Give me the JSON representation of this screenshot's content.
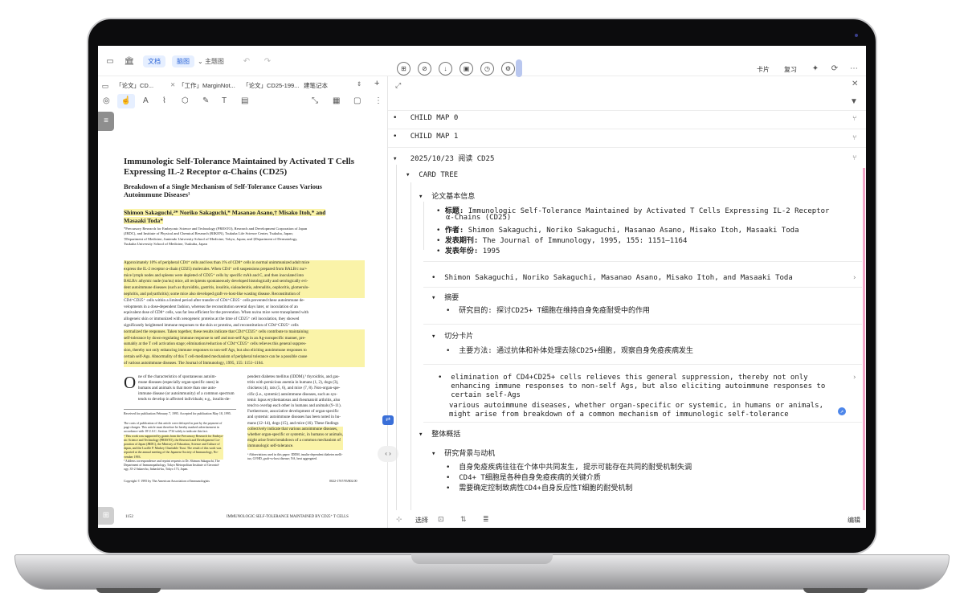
{
  "toolbar": {
    "tab_doc": "文档",
    "tab_map": "脑图",
    "theme_label": "主题图",
    "card_label": "卡片",
    "review_label": "复习"
  },
  "tabs": [
    "「论文」CD...",
    "「工作」MarginNot...",
    "「论文」CD25-199...",
    "建笔记本"
  ],
  "paper": {
    "title1": "Immunologic Self-Tolerance Maintained by Activated T Cells",
    "title2": "Expressing IL-2 Receptor α-Chains (CD25)",
    "subtitle1": "Breakdown of a Single Mechanism of Self-Tolerance Causes Various",
    "subtitle2": "Autoimmune Diseases¹",
    "authors1": "Shimon Sakaguchi,²* Noriko Sakaguchi,* Masanao Asano,† Misako Itoh,* and",
    "authors2": "Masaaki Toda*",
    "affil": [
      "*Precursory Research for Embryonic Science and Technology (PRESTO), Research and Development Corporation of Japan",
      "(JRDC), and Institute of Physical and Chemical Research (RIKEN), Tsukuba Life Science Center, Tsukuba, Japan;",
      "†Department of Medicine, Juntendo University School of Medicine, Tokyo, Japan; and ‡Department of Dermatology,",
      "Tsukuba University School of Medicine, Tsukuba, Japan"
    ],
    "abstract": [
      "Approximately 10% of peripheral CD4⁺ cells and less than 1% of CD8⁺ cells in normal unimmunized adult mice",
      "express the IL-2 receptor α-chain (CD25) molecules. When CD4⁺ cell suspensions prepared from BALB/c nu/+",
      "mice lymph nodes and spleens were depleted of CD25⁺ cells by specific mAb and C, and then inoculated into",
      "BALB/c athymic nude (nu/nu) mice, all recipients spontaneously developed histologically and serologically evi-",
      "dent autoimmune diseases (such as thyroiditis, gastritis, insulitis, sialoadenitis, adrenalitis, oophoritis, glomerulo-",
      "nephritis, and polyarthritis); some mice also developed graft-vs-host-like wasting disease. Reconstitution of",
      "CD4⁺CD25⁺ cells within a limited period after transfer of CD4⁺CD25⁻ cells prevented these autoimmune de-",
      "velopments in a dose-dependent fashion, whereas the reconstitution several days later, or inoculation of an",
      "equivalent dose of CD8⁺ cells, was far less efficient for the prevention. When nu/nu mice were transplanted with",
      "allogeneic skin or immunized with xenogeneic proteins at the time of CD25⁺ cell inoculation, they showed",
      "significantly heightened immune responses to the skin or proteins, and reconstitution of CD4⁺CD25⁺ cells",
      "normalized the responses. Taken together, these results indicate that CD4⁺CD25⁺ cells contribute to maintaining",
      "self-tolerance by down-regulating immune response to self and non-self Ags in an Ag-nonspecific manner, pre-",
      "sumably at the T cell activation stage; elimination/reduction of CD4⁺CD25⁺ cells relieves this general suppres-",
      "sion, thereby not only enhancing immune responses to non-self Ags, but also eliciting autoimmune responses to",
      "certain self-Ags. Abnormality of this T cell-mediated mechanism of peripheral tolerance can be a possible cause",
      "of various autoimmune diseases.    The Journal of Immunology, 1995, 155: 1151–1164."
    ],
    "col1": [
      "ne of the characteristics of spontaneous autoim-",
      "mune diseases (especially organ-specific ones) in",
      "humans and animals is that more than one auto-",
      "immune disease (or autoimmunity) of a common spectrum",
      "tends to develop in affected individuals; e.g., insulin-de-"
    ],
    "col2": [
      "pendent diabetes mellitus (IDDM),³ thyroiditis, and gas-",
      "tritis with pernicious anemia in humans (1, 2), dogs (3),",
      "chickens (4), rats (5, 6), and mice (7, 8). Non-organ-spe-",
      "cific (i.e., systemic) autoimmune diseases, such as sys-",
      "temic lupus erythematosus and rheumatoid arthritis, also",
      "tend to overlap each other in humans and animals (9–11).",
      "Furthermore, associative development of organ-specific",
      "and systemic autoimmune diseases has been noted in hu-",
      "mans (12–14), dogs (15), and mice (16). These findings",
      "collectively indicate that various autoimmune diseases,",
      "whether organ-specific or systemic, in humans or animals,",
      "might arise from breakdown of a common mechanism of",
      "immunologic self-tolerance."
    ],
    "received": "Received for publication February 7, 1995. Accepted for publication May 18, 1995.",
    "notes": [
      "The costs of publication of this article were defrayed in part by the payment of",
      "page charges. This article must therefore be hereby marked advertisement in",
      "accordance with 18 U.S.C. Section 1734 solely to indicate this fact.",
      "¹ This work was supported by grants from the Precursory Research for Embryo-",
      "nic Science and Technology (PRESTO), the Research and Development Cor-",
      "poration of Japan (JRDC), the Ministry of Education, Science and Culture of",
      "Japan, and the Lucille P. Markey Charitable Trust. The result of this work was",
      "reported at the annual meeting of the Japanese Society of Immunology, No-",
      "vember 1993.",
      "² Address correspondence and reprint requests to Dr. Shimon Sakaguchi, The",
      "Department of Immunopathology, Tokyo Metropolitan Institute of Gerontol-",
      "ogy, 35-2 Sakaecho, Itabashi-ku, Tokyo 173, Japan."
    ],
    "abbrev": [
      "³ Abbreviations used in this paper: IDDM, insulin-dependent diabetes melli-",
      "tus; GVHD, graft-vs-host disease; NA, beat aggregated."
    ],
    "copyright": "Copyright © 1995 by The American Association of Immunologists",
    "issn": "0022-1767/95/$02.00",
    "page_num": "1152",
    "running": "IMMUNOLOGIC SELF-TOLERANCE MAINTAINED BY CD25⁺ T CELLS"
  },
  "tree": {
    "child0": "CHILD MAP 0",
    "child1": "CHILD MAP 1",
    "date_node": "2025/10/23 阅读 CD25",
    "card_tree": "CARD TREE",
    "basic_info": "论文基本信息",
    "title_label": "标题",
    "title_val": "Immunologic Self-Tolerance Maintained by Activated T Cells Expressing IL-2 Receptor",
    "title_val2": "α-Chains (CD25)",
    "author_label": "作者",
    "author_val": "Shimon Sakaguchi, Noriko Sakaguchi, Masanao Asano, Misako Itoh, Masaaki Toda",
    "journal_label": "发表期刊",
    "journal_val": "The Journal of Immunology, 1995, 155: 1151–1164",
    "year_label": "发表年份",
    "year_val": "1995",
    "authors_node": "Shimon Sakaguchi, Noriko Sakaguchi, Masanao Asano, Misako Itoh, and Masaaki Toda",
    "abstract_node": "摘要",
    "purpose": "研究目的: 探讨CD25+ T细胞在维持自身免疫耐受中的作用",
    "cut_card": "切分卡片",
    "method": "主要方法: 通过抗体和补体处理去除CD25+细胞, 观察自身免疫疾病发生",
    "elim1": "elimination of CD4+CD25+ cells relieves this general suppression, thereby not only",
    "elim2": "enhancing immune responses to non-self Ags, but also eliciting autoimmune responses to",
    "elim3": "certain self-Ags",
    "var1": "various autoimmune diseases, whether organ-specific or systemic, in humans or animals,",
    "var2": "might arise from breakdown of a common mechanism of immunologic self-tolerance",
    "overview": "整体概括",
    "background": "研究背景与动机",
    "bg1": "自身免疫疾病往往在个体中共同发生, 提示可能存在共同的耐受机制失调",
    "bg2": "CD4+ T细胞是各种自身免疫疾病的关键介质",
    "bg3": "需要确定控制致病性CD4+自身反应性T细胞的耐受机制"
  },
  "bottom": {
    "select": "选择",
    "edit": "编辑"
  }
}
